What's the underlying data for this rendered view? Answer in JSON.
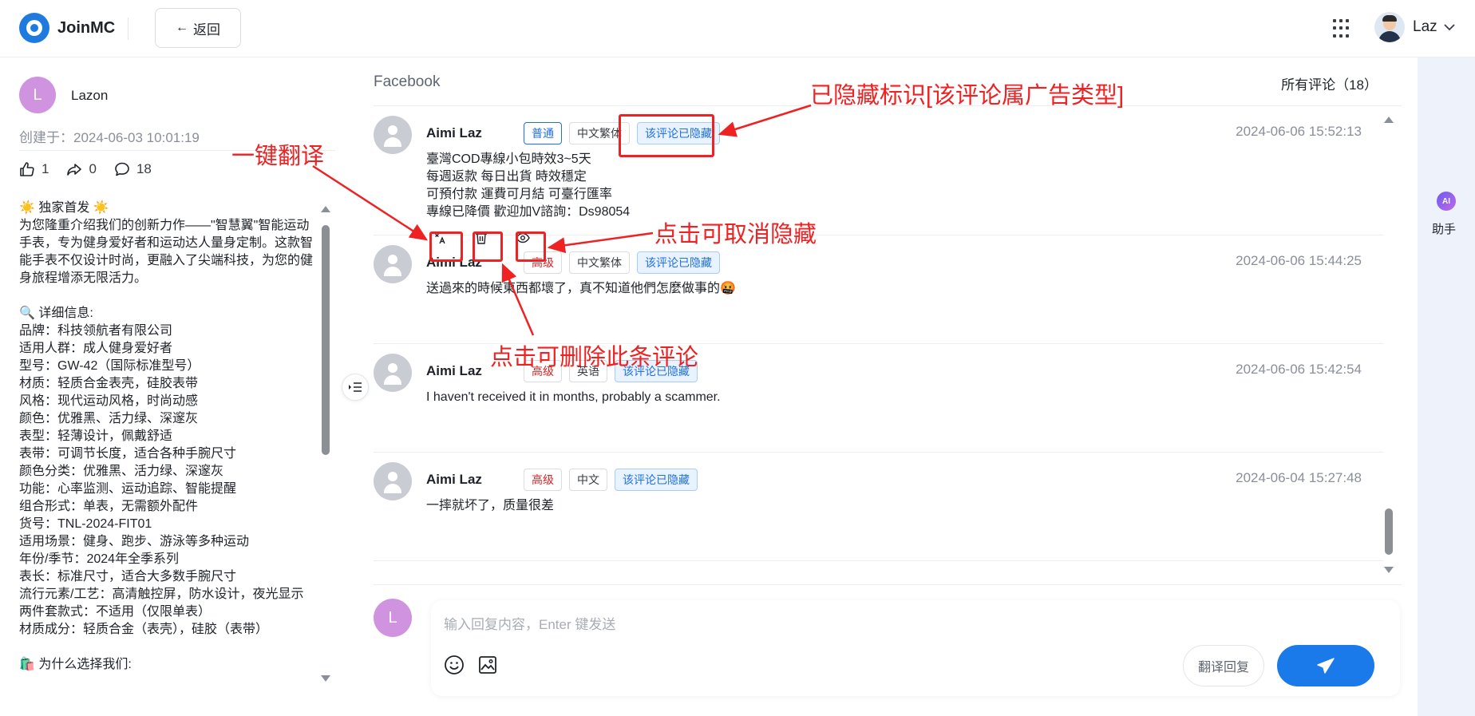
{
  "app": {
    "name": "JoinMC",
    "back_label": "返回"
  },
  "user": {
    "name": "Laz"
  },
  "post": {
    "author": "Lazon",
    "avatar_letter": "L",
    "created": "创建于：2024-06-03 10:01:19",
    "likes": "1",
    "shares": "0",
    "comments": "18",
    "content": "☀️ 独家首发 ☀️\n为您隆重介绍我们的创新力作——\"智慧翼\"智能运动手表，专为健身爱好者和运动达人量身定制。这款智能手表不仅设计时尚，更融入了尖端科技，为您的健身旅程增添无限活力。\n\n🔍 详细信息:\n品牌：科技领航者有限公司\n适用人群：成人健身爱好者\n型号：GW-42（国际标准型号）\n材质：轻质合金表壳，硅胶表带\n风格：现代运动风格，时尚动感\n颜色：优雅黑、活力绿、深邃灰\n表型：轻薄设计，佩戴舒适\n表带：可调节长度，适合各种手腕尺寸\n颜色分类：优雅黑、活力绿、深邃灰\n功能：心率监测、运动追踪、智能提醒\n组合形式：单表，无需额外配件\n货号：TNL-2024-FIT01\n适用场景：健身、跑步、游泳等多种运动\n年份/季节：2024年全季系列\n表长：标准尺寸，适合大多数手腕尺寸\n流行元素/工艺：高清触控屏，防水设计，夜光显示\n两件套款式：不适用（仅限单表）\n材质成分：轻质合金（表壳），硅胶（表带）\n\n🛍️ 为什么选择我们:"
  },
  "main": {
    "platform": "Facebook",
    "all_comments": "所有评论（18）"
  },
  "comments": [
    {
      "name": "Aimi Laz",
      "level": "普通",
      "language": "中文繁体",
      "hidden_tag": "该评论已隐藏",
      "time": "2024-06-06 15:52:13",
      "text": "臺灣COD專線小包時效3~5天\n每週返款 每日出貨 時效穩定\n可預付款 運費可月結 可臺行匯率\n專線已降價 歡迎加V諮詢：Ds98054"
    },
    {
      "name": "Aimi Laz",
      "level": "高级",
      "language": "中文繁体",
      "hidden_tag": "该评论已隐藏",
      "time": "2024-06-06 15:44:25",
      "text": "送過來的時候東西都壞了，真不知道他們怎麼做事的🤬"
    },
    {
      "name": "Aimi Laz",
      "level": "高级",
      "language": "英语",
      "hidden_tag": "该评论已隐藏",
      "time": "2024-06-06 15:42:54",
      "text": "I haven't received it in months, probably a scammer."
    },
    {
      "name": "Aimi Laz",
      "level": "高级",
      "language": "中文",
      "hidden_tag": "该评论已隐藏",
      "time": "2024-06-04 15:27:48",
      "text": "一摔就坏了，质量很差"
    }
  ],
  "composer": {
    "avatar_letter": "L",
    "placeholder": "输入回复内容，Enter 键发送",
    "translate_label": "翻译回复"
  },
  "right_rail": {
    "ai_badge": "AI",
    "assistant_label": "助手"
  },
  "annotations": {
    "hidden_marker": "已隐藏标识[该评论属广告类型]",
    "translate": "一键翻译",
    "unhide": "点击可取消隐藏",
    "delete": "点击可删除此条评论"
  },
  "colors": {
    "accent": "#1a7aea",
    "annotation": "#ee2222",
    "avatar": "#cf93e0"
  }
}
